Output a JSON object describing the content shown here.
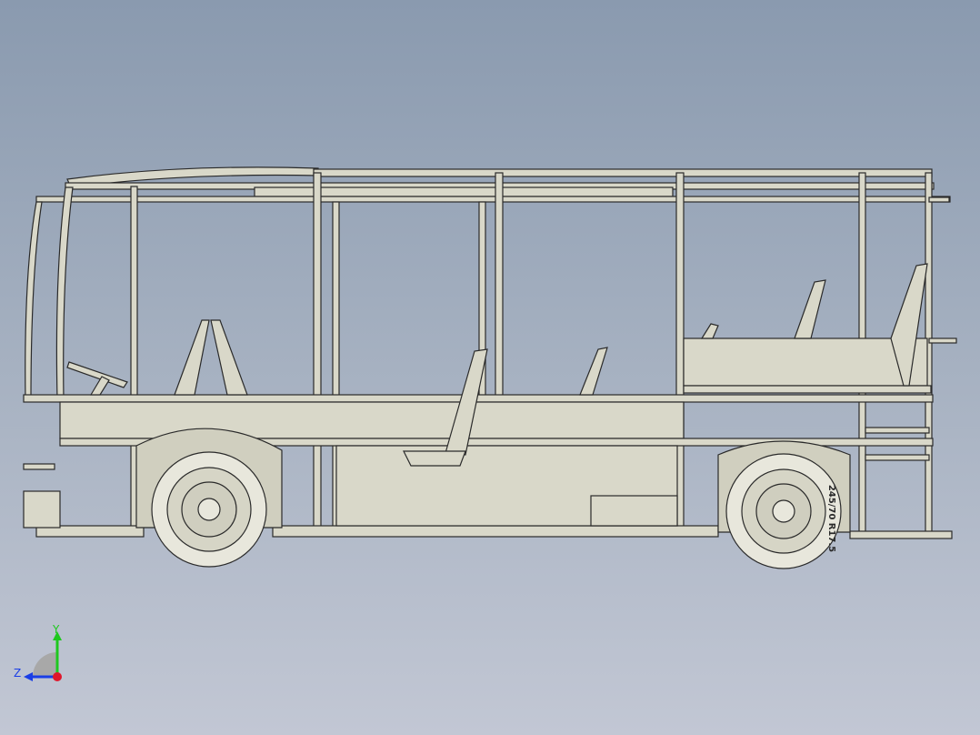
{
  "viewport": {
    "background_top": "#8a9aaf",
    "background_bottom": "#c2c7d4",
    "model_color": "#d9d8c9",
    "edge_color": "#2a2a2a",
    "tire_text": "245/70 R17.5"
  },
  "triad": {
    "x_label": "",
    "y_label": "Y",
    "z_label": "Z",
    "x_color": "#e0162b",
    "y_color": "#1ec81e",
    "z_color": "#1a3ee6"
  }
}
